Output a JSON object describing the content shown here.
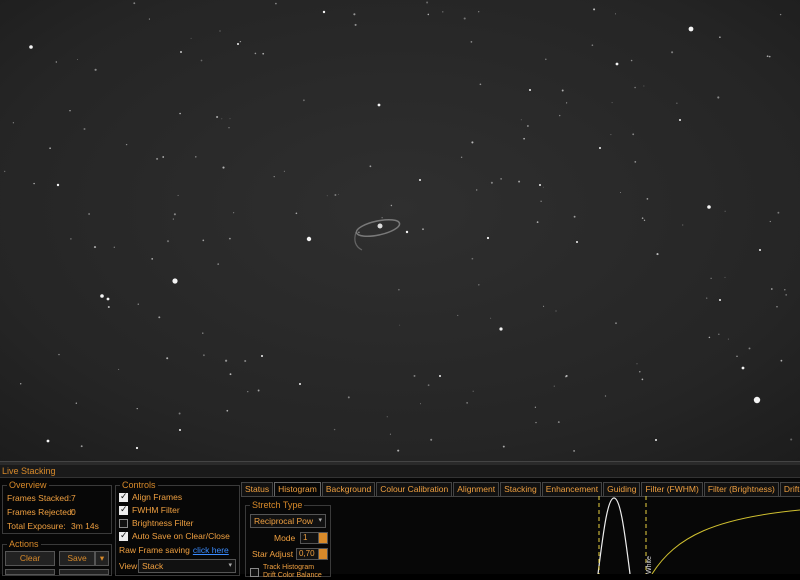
{
  "panel": {
    "title": "Live Stacking"
  },
  "overview": {
    "title": "Overview",
    "frames_stacked_label": "Frames Stacked:",
    "frames_stacked_value": "7",
    "frames_rejected_label": "Frames Rejected:",
    "frames_rejected_value": "0",
    "total_exposure_label": "Total Exposure:",
    "total_exposure_value": "3m 14s"
  },
  "actions": {
    "title": "Actions",
    "clear_label": "Clear",
    "save_label": "Save",
    "save_dropdown_icon": "chevron-down-icon"
  },
  "controls": {
    "title": "Controls",
    "align_frames": {
      "label": "Align Frames",
      "checked": true
    },
    "fwhm_filter": {
      "label": "FWHM Filter",
      "checked": true
    },
    "brightness_filter": {
      "label": "Brightness Filter",
      "checked": false
    },
    "auto_save": {
      "label": "Auto Save on Clear/Close",
      "checked": true
    },
    "raw_frame_label": "Raw Frame saving",
    "raw_frame_link": "click here",
    "view_label": "View",
    "view_value": "Stack"
  },
  "tabs": [
    "Status",
    "Histogram",
    "Background",
    "Colour Calibration",
    "Alignment",
    "Stacking",
    "Enhancement",
    "Guiding",
    "Filter (FWHM)",
    "Filter (Brightness)",
    "Drift Grap"
  ],
  "active_tab": "Histogram",
  "stretch": {
    "title": "Stretch Type",
    "type_value": "Reciprocal Pow",
    "mode_label": "Mode",
    "mode_value": "1",
    "star_adjust_label": "Star Adjust",
    "star_adjust_value": "0,70",
    "track_histogram_label": "Track Histogram",
    "drift_label": "Drift Color Balance",
    "track_histogram_checked": false
  },
  "histogram": {
    "marker_label": "White"
  }
}
